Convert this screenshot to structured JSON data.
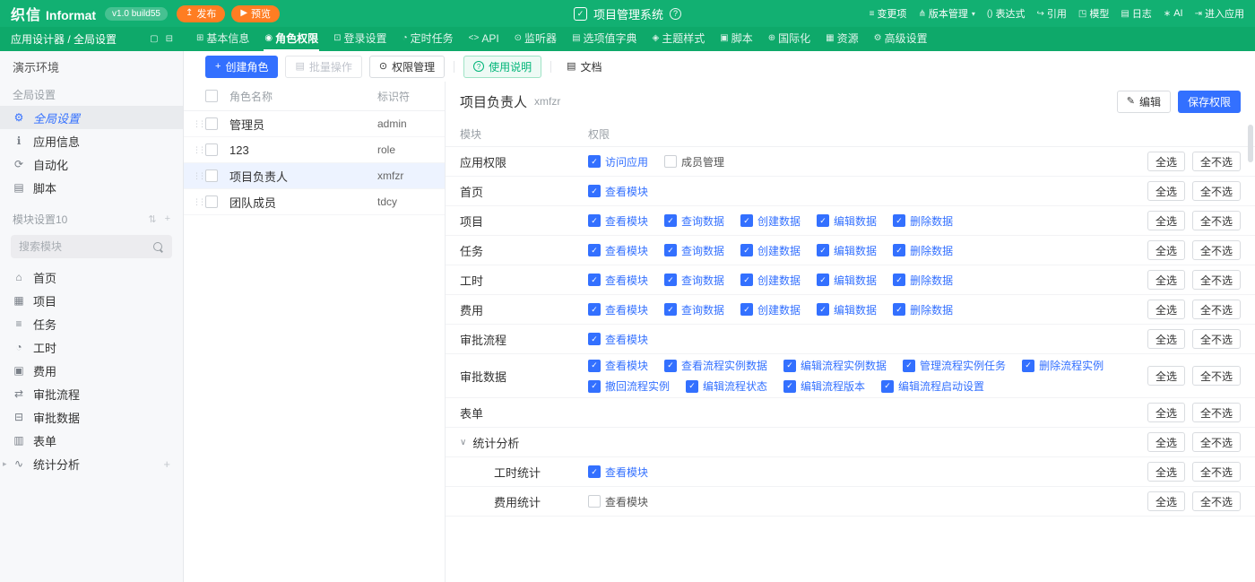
{
  "colors": {
    "brand_green": "#12b072",
    "nav_green": "#0ea96a",
    "accent_blue": "#3370ff",
    "orange": "#ff7d22",
    "success_green": "#00b578",
    "selected_row_bg": "#edf3ff"
  },
  "topbar": {
    "logo_cn": "织信",
    "logo_en": "Informat",
    "version": "v1.0 build55",
    "publish": "发布",
    "preview": "预览",
    "app_title": "项目管理系统",
    "right_items": [
      {
        "label": "变更项",
        "icon": "≡",
        "icon_name": "changes-icon"
      },
      {
        "label": "版本管理",
        "icon": "⋔",
        "icon_name": "version-branch-icon",
        "caret": true
      },
      {
        "label": "表达式",
        "icon": "()",
        "icon_name": "expression-icon"
      },
      {
        "label": "引用",
        "icon": "↪",
        "icon_name": "reference-icon"
      },
      {
        "label": "模型",
        "icon": "◳",
        "icon_name": "model-icon"
      },
      {
        "label": "日志",
        "icon": "▤",
        "icon_name": "logs-icon"
      },
      {
        "label": "AI",
        "icon": "∗",
        "icon_name": "ai-icon"
      },
      {
        "label": "进入应用",
        "icon": "⇥",
        "icon_name": "enter-app-icon"
      }
    ]
  },
  "navbar": {
    "breadcrumb": "应用设计器 / 全局设置",
    "corner_icons": [
      {
        "icon": "▢",
        "icon_name": "display-icon"
      },
      {
        "icon": "⊟",
        "icon_name": "layout-icon"
      }
    ],
    "items": [
      {
        "label": "基本信息",
        "icon": "⊞",
        "icon_name": "basic-info-icon",
        "active": false
      },
      {
        "label": "角色权限",
        "icon": "◉",
        "icon_name": "role-permission-icon",
        "active": true
      },
      {
        "label": "登录设置",
        "icon": "⊡",
        "icon_name": "login-settings-icon",
        "active": false
      },
      {
        "label": "定时任务",
        "icon": "◔",
        "icon_name": "cron-task-icon",
        "active": false
      },
      {
        "label": "API",
        "icon": "<>",
        "icon_name": "api-icon",
        "active": false
      },
      {
        "label": "监听器",
        "icon": "⊙",
        "icon_name": "listener-icon",
        "active": false
      },
      {
        "label": "选项值字典",
        "icon": "▤",
        "icon_name": "dictionary-icon",
        "active": false
      },
      {
        "label": "主题样式",
        "icon": "◈",
        "icon_name": "theme-icon",
        "active": false
      },
      {
        "label": "脚本",
        "icon": "▣",
        "icon_name": "script-icon",
        "active": false
      },
      {
        "label": "国际化",
        "icon": "⊕",
        "icon_name": "i18n-icon",
        "active": false
      },
      {
        "label": "资源",
        "icon": "▦",
        "icon_name": "resource-icon",
        "active": false
      },
      {
        "label": "高级设置",
        "icon": "⚙",
        "icon_name": "advanced-settings-icon",
        "active": false
      }
    ]
  },
  "sidebar": {
    "environment": "演示环境",
    "global_section": "全局设置",
    "global_items": [
      {
        "label": "全局设置",
        "icon": "⚙",
        "icon_name": "gear-icon",
        "active": true
      },
      {
        "label": "应用信息",
        "icon": "ℹ",
        "icon_name": "info-icon",
        "active": false
      },
      {
        "label": "自动化",
        "icon": "⟳",
        "icon_name": "automation-icon",
        "active": false
      },
      {
        "label": "脚本",
        "icon": "▤",
        "icon_name": "script-icon",
        "active": false
      }
    ],
    "module_section": "模块设置10",
    "module_section_icons": [
      {
        "icon": "⇅",
        "icon_name": "sort-icon"
      },
      {
        "icon": "+",
        "icon_name": "add-module-icon"
      }
    ],
    "search_placeholder": "搜索模块",
    "modules": [
      {
        "label": "首页",
        "icon": "⌂",
        "icon_name": "home-icon"
      },
      {
        "label": "项目",
        "icon": "▦",
        "icon_name": "project-icon"
      },
      {
        "label": "任务",
        "icon": "≡",
        "icon_name": "task-icon"
      },
      {
        "label": "工时",
        "icon": "◔",
        "icon_name": "work-hours-icon"
      },
      {
        "label": "费用",
        "icon": "▣",
        "icon_name": "expense-icon"
      },
      {
        "label": "审批流程",
        "icon": "⇄",
        "icon_name": "approval-flow-icon"
      },
      {
        "label": "审批数据",
        "icon": "⊟",
        "icon_name": "approval-data-icon"
      },
      {
        "label": "表单",
        "icon": "▥",
        "icon_name": "form-icon"
      },
      {
        "label": "统计分析",
        "icon": "∿",
        "icon_name": "statistics-icon",
        "expandable": true,
        "plus": true
      }
    ]
  },
  "toolbar": {
    "create": "创建角色",
    "batch": "批量操作",
    "perm_manage": "权限管理",
    "usage": "使用说明",
    "doc": "文档"
  },
  "role_list": {
    "name_col": "角色名称",
    "code_col": "标识符",
    "rows": [
      {
        "name": "管理员",
        "code": "admin",
        "selected": false
      },
      {
        "name": "123",
        "code": "role",
        "selected": false
      },
      {
        "name": "项目负责人",
        "code": "xmfzr",
        "selected": true
      },
      {
        "name": "团队成员",
        "code": "tdcy",
        "selected": false
      }
    ]
  },
  "detail": {
    "title": "项目负责人",
    "code": "xmfzr",
    "edit": "编辑",
    "save": "保存权限",
    "module_col": "模块",
    "perm_col": "权限",
    "select_all": "全选",
    "select_none": "全不选",
    "rows": [
      {
        "module": "应用权限",
        "perms": [
          {
            "label": "访问应用",
            "checked": true
          },
          {
            "label": "成员管理",
            "checked": false
          }
        ]
      },
      {
        "module": "首页",
        "perms": [
          {
            "label": "查看模块",
            "checked": true
          }
        ]
      },
      {
        "module": "项目",
        "perms": [
          {
            "label": "查看模块",
            "checked": true
          },
          {
            "label": "查询数据",
            "checked": true
          },
          {
            "label": "创建数据",
            "checked": true
          },
          {
            "label": "编辑数据",
            "checked": true
          },
          {
            "label": "删除数据",
            "checked": true
          }
        ]
      },
      {
        "module": "任务",
        "perms": [
          {
            "label": "查看模块",
            "checked": true
          },
          {
            "label": "查询数据",
            "checked": true
          },
          {
            "label": "创建数据",
            "checked": true
          },
          {
            "label": "编辑数据",
            "checked": true
          },
          {
            "label": "删除数据",
            "checked": true
          }
        ]
      },
      {
        "module": "工时",
        "perms": [
          {
            "label": "查看模块",
            "checked": true
          },
          {
            "label": "查询数据",
            "checked": true
          },
          {
            "label": "创建数据",
            "checked": true
          },
          {
            "label": "编辑数据",
            "checked": true
          },
          {
            "label": "删除数据",
            "checked": true
          }
        ]
      },
      {
        "module": "费用",
        "perms": [
          {
            "label": "查看模块",
            "checked": true
          },
          {
            "label": "查询数据",
            "checked": true
          },
          {
            "label": "创建数据",
            "checked": true
          },
          {
            "label": "编辑数据",
            "checked": true
          },
          {
            "label": "删除数据",
            "checked": true
          }
        ]
      },
      {
        "module": "审批流程",
        "perms": [
          {
            "label": "查看模块",
            "checked": true
          }
        ]
      },
      {
        "module": "审批数据",
        "perms": [
          {
            "label": "查看模块",
            "checked": true
          },
          {
            "label": "查看流程实例数据",
            "checked": true
          },
          {
            "label": "编辑流程实例数据",
            "checked": true
          },
          {
            "label": "管理流程实例任务",
            "checked": true
          },
          {
            "label": "删除流程实例",
            "checked": true
          },
          {
            "label": "撤回流程实例",
            "checked": true
          },
          {
            "label": "编辑流程状态",
            "checked": true
          },
          {
            "label": "编辑流程版本",
            "checked": true
          },
          {
            "label": "编辑流程启动设置",
            "checked": true
          }
        ]
      },
      {
        "module": "表单",
        "perms": []
      },
      {
        "module": "统计分析",
        "group": true,
        "perms": []
      },
      {
        "module": "工时统计",
        "child": true,
        "perms": [
          {
            "label": "查看模块",
            "checked": true
          }
        ]
      },
      {
        "module": "费用统计",
        "child": true,
        "perms": [
          {
            "label": "查看模块",
            "checked": false
          }
        ]
      }
    ]
  }
}
